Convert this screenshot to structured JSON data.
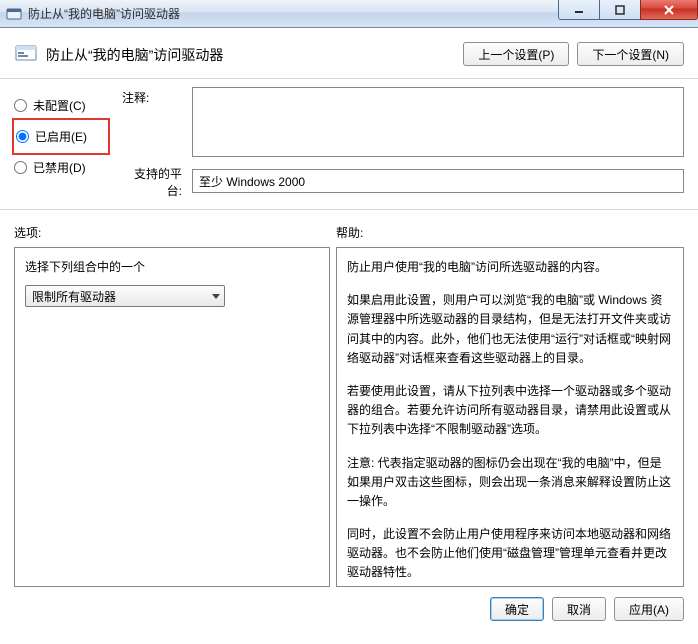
{
  "window": {
    "title": "防止从“我的电脑”访问驱动器"
  },
  "header": {
    "title": "防止从“我的电脑”访问驱动器",
    "prev_button": "上一个设置(P)",
    "next_button": "下一个设置(N)"
  },
  "state_radios": {
    "not_configured": "未配置(C)",
    "enabled": "已启用(E)",
    "disabled": "已禁用(D)",
    "selected": "enabled"
  },
  "meta": {
    "comment_label": "注释:",
    "comment_value": "",
    "platform_label": "支持的平台:",
    "platform_value": "至少 Windows 2000"
  },
  "sections": {
    "options_label": "选项:",
    "help_label": "帮助:"
  },
  "options": {
    "prompt": "选择下列组合中的一个",
    "combo_selected": "限制所有驱动器"
  },
  "help": {
    "p1": "防止用户使用“我的电脑”访问所选驱动器的内容。",
    "p2": "如果启用此设置，则用户可以浏览“我的电脑”或 Windows 资源管理器中所选驱动器的目录结构，但是无法打开文件夹或访问其中的内容。此外，他们也无法使用“运行”对话框或“映射网络驱动器”对话框来查看这些驱动器上的目录。",
    "p3": "若要使用此设置，请从下拉列表中选择一个驱动器或多个驱动器的组合。若要允许访问所有驱动器目录，请禁用此设置或从下拉列表中选择“不限制驱动器”选项。",
    "p4": "注意: 代表指定驱动器的图标仍会出现在“我的电脑”中，但是如果用户双击这些图标，则会出现一条消息来解释设置防止这一操作。",
    "p5": "同时，此设置不会防止用户使用程序来访问本地驱动器和网络驱动器。也不会防止他们使用“磁盘管理”管理单元查看并更改驱动器特性。"
  },
  "footer": {
    "ok": "确定",
    "cancel": "取消",
    "apply": "应用(A)"
  }
}
